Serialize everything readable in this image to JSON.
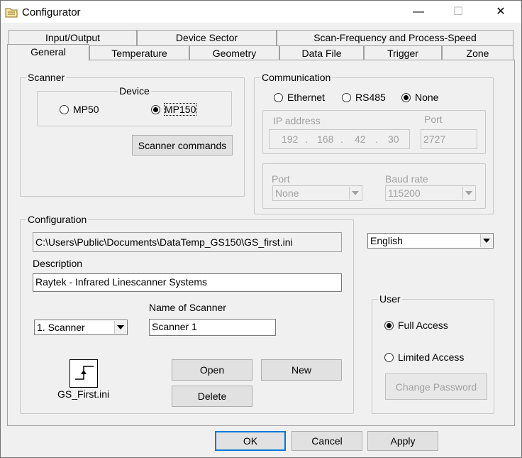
{
  "window": {
    "title": "Configurator",
    "minimize": "—",
    "maximize": "☐",
    "close": "✕"
  },
  "tabs_back": [
    "Input/Output",
    "Device Sector",
    "Scan-Frequency and Process-Speed"
  ],
  "tabs_front": [
    "General",
    "Temperature",
    "Geometry",
    "Data File",
    "Trigger",
    "Zone"
  ],
  "active_tab": "General",
  "scanner": {
    "label": "Scanner",
    "device_label": "Device",
    "options": [
      {
        "label": "MP50",
        "checked": false
      },
      {
        "label": "MP150",
        "checked": true
      }
    ],
    "commands_button": "Scanner commands"
  },
  "communication": {
    "label": "Communication",
    "options": [
      {
        "label": "Ethernet",
        "checked": false
      },
      {
        "label": "RS485",
        "checked": false
      },
      {
        "label": "None",
        "checked": true
      }
    ],
    "ip_label": "IP address",
    "ip": [
      "192",
      "168",
      "42",
      "30"
    ],
    "ip_port_label": "Port",
    "ip_port": "2727",
    "serial_port_label": "Port",
    "serial_port": "None",
    "baud_label": "Baud rate",
    "baud": "115200"
  },
  "configuration": {
    "label": "Configuration",
    "path": "C:\\Users\\Public\\Documents\\DataTemp_GS150\\GS_first.ini",
    "description_label": "Description",
    "description": "Raytek - Infrared Linescanner Systems",
    "scanner_select": "1. Scanner",
    "name_label": "Name of Scanner",
    "name": "Scanner 1",
    "file_name": "GS_First.ini",
    "open_button": "Open",
    "new_button": "New",
    "delete_button": "Delete"
  },
  "language": "English",
  "user": {
    "label": "User",
    "options": [
      {
        "label": "Full Access",
        "checked": true
      },
      {
        "label": "Limited Access",
        "checked": false
      }
    ],
    "change_password": "Change Password"
  },
  "footer": {
    "ok": "OK",
    "cancel": "Cancel",
    "apply": "Apply"
  }
}
